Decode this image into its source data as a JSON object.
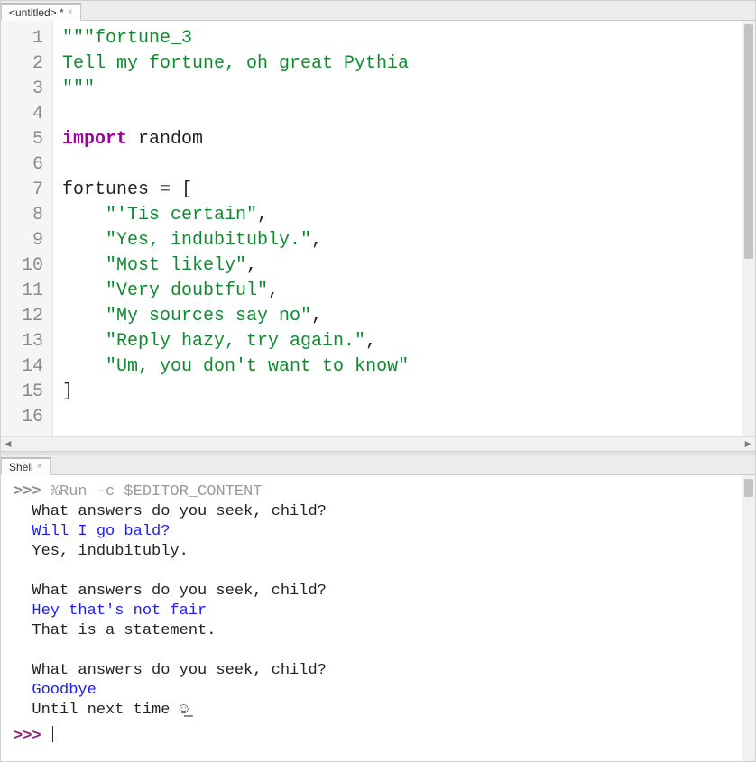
{
  "editor": {
    "tab_title": "<untitled> *",
    "lines": [
      {
        "n": 1,
        "tokens": [
          {
            "c": "tok-str",
            "t": "\"\"\"fortune_3"
          }
        ]
      },
      {
        "n": 2,
        "tokens": [
          {
            "c": "tok-str",
            "t": ""
          }
        ]
      },
      {
        "n": 3,
        "tokens": [
          {
            "c": "tok-str",
            "t": "Tell my fortune, oh great Pythia"
          }
        ]
      },
      {
        "n": 4,
        "tokens": [
          {
            "c": "tok-str",
            "t": "\"\"\""
          }
        ]
      },
      {
        "n": 5,
        "tokens": []
      },
      {
        "n": 6,
        "tokens": [
          {
            "c": "tok-kw",
            "t": "import"
          },
          {
            "c": "tok-name",
            "t": " random"
          }
        ]
      },
      {
        "n": 7,
        "tokens": []
      },
      {
        "n": 8,
        "tokens": [
          {
            "c": "tok-name",
            "t": "fortunes "
          },
          {
            "c": "tok-op",
            "t": "="
          },
          {
            "c": "tok-name",
            "t": " "
          },
          {
            "c": "tok-pun",
            "t": "["
          }
        ]
      },
      {
        "n": 9,
        "tokens": [
          {
            "c": "",
            "t": "    "
          },
          {
            "c": "tok-str",
            "t": "\"'Tis certain\""
          },
          {
            "c": "tok-pun",
            "t": ","
          }
        ]
      },
      {
        "n": 10,
        "tokens": [
          {
            "c": "",
            "t": "    "
          },
          {
            "c": "tok-str",
            "t": "\"Yes, indubitubly.\""
          },
          {
            "c": "tok-pun",
            "t": ","
          }
        ]
      },
      {
        "n": 11,
        "tokens": [
          {
            "c": "",
            "t": "    "
          },
          {
            "c": "tok-str",
            "t": "\"Most likely\""
          },
          {
            "c": "tok-pun",
            "t": ","
          }
        ]
      },
      {
        "n": 12,
        "tokens": [
          {
            "c": "",
            "t": "    "
          },
          {
            "c": "tok-str",
            "t": "\"Very doubtful\""
          },
          {
            "c": "tok-pun",
            "t": ","
          }
        ]
      },
      {
        "n": 13,
        "tokens": [
          {
            "c": "",
            "t": "    "
          },
          {
            "c": "tok-str",
            "t": "\"My sources say no\""
          },
          {
            "c": "tok-pun",
            "t": ","
          }
        ]
      },
      {
        "n": 14,
        "tokens": [
          {
            "c": "",
            "t": "    "
          },
          {
            "c": "tok-str",
            "t": "\"Reply hazy, try again.\""
          },
          {
            "c": "tok-pun",
            "t": ","
          }
        ]
      },
      {
        "n": 15,
        "tokens": [
          {
            "c": "",
            "t": "    "
          },
          {
            "c": "tok-str",
            "t": "\"Um, you don't want to know\""
          }
        ]
      },
      {
        "n": 16,
        "tokens": [
          {
            "c": "tok-pun",
            "t": "]"
          }
        ]
      }
    ]
  },
  "shell": {
    "tab_title": "Shell",
    "prompt_symbol": ">>>",
    "run_command": "%Run -c $EDITOR_CONTENT",
    "blocks": [
      {
        "kind": "run"
      },
      {
        "kind": "out",
        "text": "What answers do you seek, child?"
      },
      {
        "kind": "input",
        "text": "Will I go bald?"
      },
      {
        "kind": "out",
        "text": "Yes, indubitubly."
      },
      {
        "kind": "blank"
      },
      {
        "kind": "out",
        "text": "What answers do you seek, child?"
      },
      {
        "kind": "input",
        "text": "Hey that's not fair"
      },
      {
        "kind": "out",
        "text": "That is a statement."
      },
      {
        "kind": "blank"
      },
      {
        "kind": "out",
        "text": "What answers do you seek, child?"
      },
      {
        "kind": "input",
        "text": "Goodbye"
      },
      {
        "kind": "out",
        "text": "Until next time ☺̲"
      },
      {
        "kind": "prompt"
      }
    ]
  }
}
